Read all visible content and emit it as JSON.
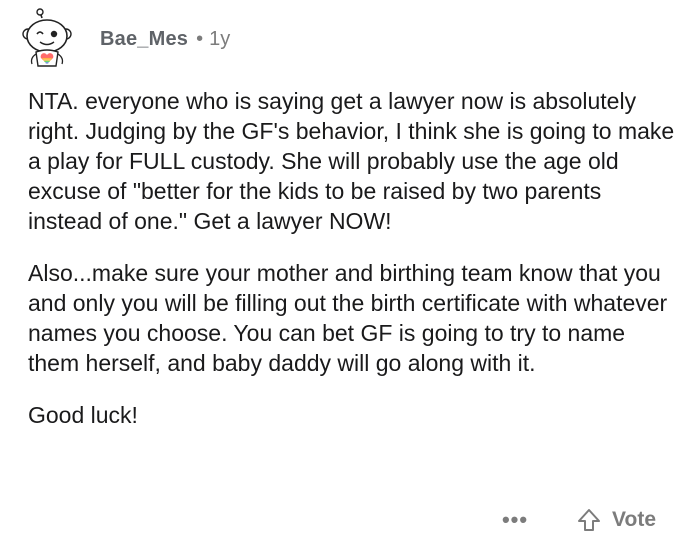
{
  "comment": {
    "username": "Bae_Mes",
    "separator": "•",
    "age": "1y",
    "paragraphs": [
      "NTA. everyone who is saying get a lawyer now is absolutely right. Judging by the GF's behavior, I think she is going to make a play for FULL custody. She will probably use the age old excuse of \"better for the kids to be raised by two parents instead of one.\" Get a lawyer NOW!",
      "Also...make sure your mother and birthing team know that you and only you will be filling out the birth certificate with whatever names you choose. You can bet GF is going to try to name them herself, and baby daddy will go along with it.",
      "Good luck!"
    ],
    "actions": {
      "more_label": "•••",
      "vote_label": "Vote",
      "vote_icon": "upvote-arrow-icon",
      "more_icon": "more-options-icon"
    },
    "colors": {
      "username": "#5f6368",
      "meta": "#7c7c7c",
      "body_text": "#1a1a1b"
    }
  }
}
